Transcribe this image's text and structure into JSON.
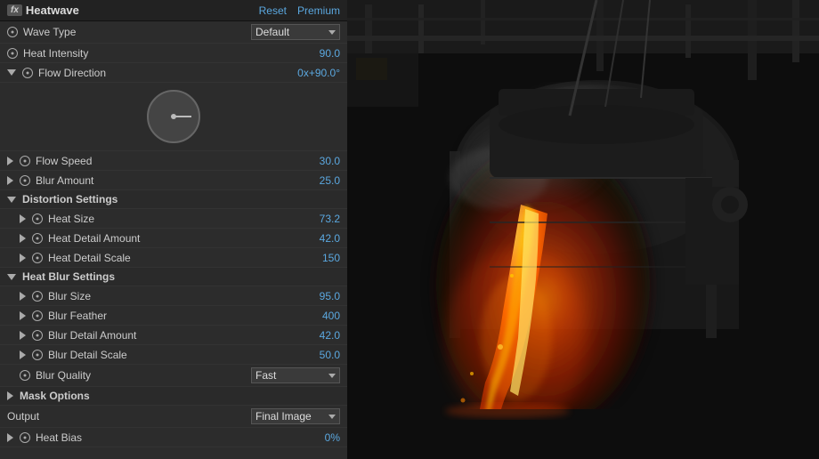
{
  "header": {
    "fx_label": "fx",
    "title": "Heatwave",
    "reset_label": "Reset",
    "premium_label": "Premium"
  },
  "controls": {
    "wave_type": {
      "label": "Wave Type",
      "value": "Default"
    },
    "heat_intensity": {
      "label": "Heat Intensity",
      "value": "90.0"
    },
    "flow_direction": {
      "label": "Flow Direction",
      "value": "0x+90.0°"
    },
    "flow_speed": {
      "label": "Flow Speed",
      "value": "30.0"
    },
    "blur_amount": {
      "label": "Blur Amount",
      "value": "25.0"
    },
    "distortion_settings": {
      "label": "Distortion Settings"
    },
    "heat_size": {
      "label": "Heat Size",
      "value": "73.2"
    },
    "heat_detail_amount": {
      "label": "Heat Detail Amount",
      "value": "42.0"
    },
    "heat_detail_scale": {
      "label": "Heat Detail Scale",
      "value": "150"
    },
    "heat_blur_settings": {
      "label": "Heat Blur Settings"
    },
    "blur_size": {
      "label": "Blur Size",
      "value": "95.0"
    },
    "blur_feather": {
      "label": "Blur Feather",
      "value": "400"
    },
    "blur_detail_amount": {
      "label": "Blur Detail Amount",
      "value": "42.0"
    },
    "blur_detail_scale": {
      "label": "Blur Detail Scale",
      "value": "50.0"
    },
    "blur_quality": {
      "label": "Blur Quality",
      "value": "Fast"
    },
    "mask_options": {
      "label": "Mask Options"
    },
    "output": {
      "label": "Output",
      "value": "Final Image"
    },
    "heat_bias": {
      "label": "Heat Bias",
      "value": "0%"
    }
  }
}
